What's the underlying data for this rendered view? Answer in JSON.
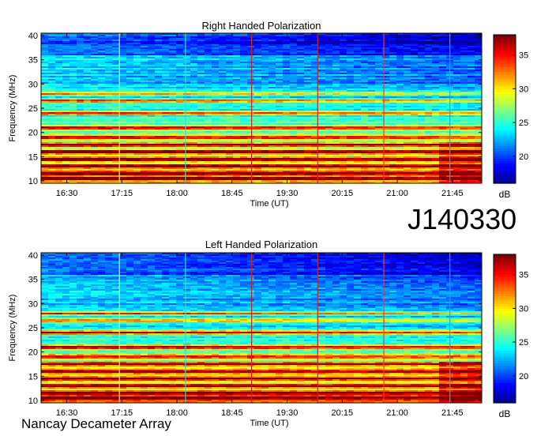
{
  "figure": {
    "observation_id": "J140330",
    "footer": "Nancay Decameter Array"
  },
  "chart_data": [
    {
      "type": "heatmap",
      "title": "Right Handed Polarization",
      "xlabel": "Time (UT)",
      "ylabel": "Frequency (MHz)",
      "x_ticks": [
        "16:30",
        "17:15",
        "18:00",
        "18:45",
        "19:30",
        "20:15",
        "21:00",
        "21:45"
      ],
      "y_ticks": [
        10,
        15,
        20,
        25,
        30,
        35,
        40
      ],
      "ylim": [
        9.5,
        40.5
      ],
      "colorbar": {
        "label": "dB",
        "ticks": [
          20,
          25,
          30,
          35
        ],
        "range": [
          16,
          38
        ],
        "colormap": "jet"
      },
      "bright_bands_mhz": [
        10.5,
        11.5,
        13,
        14.5,
        16,
        17.5,
        19,
        21,
        24,
        26.5,
        28
      ],
      "vertical_markers": [
        {
          "time": "17:13",
          "color": "#ccff66"
        },
        {
          "time": "18:07",
          "color": "#33ddcc"
        },
        {
          "time": "19:01",
          "color": "#cc2222"
        },
        {
          "time": "19:55",
          "color": "#cc2222"
        },
        {
          "time": "20:49",
          "color": "#ff3333"
        },
        {
          "time": "21:43",
          "color": "#3399ff"
        }
      ]
    },
    {
      "type": "heatmap",
      "title": "Left Handed Polarization",
      "xlabel": "Time (UT)",
      "ylabel": "Frequency (MHz)",
      "x_ticks": [
        "16:30",
        "17:15",
        "18:00",
        "18:45",
        "19:30",
        "20:15",
        "21:00",
        "21:45"
      ],
      "y_ticks": [
        10,
        15,
        20,
        25,
        30,
        35,
        40
      ],
      "ylim": [
        9.5,
        40.5
      ],
      "colorbar": {
        "label": "dB",
        "ticks": [
          20,
          25,
          30,
          35
        ],
        "range": [
          16,
          38
        ],
        "colormap": "jet"
      },
      "bright_bands_mhz": [
        10.5,
        11.5,
        13,
        14.5,
        16,
        17.5,
        19,
        21,
        24,
        26.5,
        28
      ],
      "vertical_markers": [
        {
          "time": "17:13",
          "color": "#ccff66"
        },
        {
          "time": "18:07",
          "color": "#33ddcc"
        },
        {
          "time": "19:01",
          "color": "#cc2222"
        },
        {
          "time": "19:55",
          "color": "#cc2222"
        },
        {
          "time": "20:49",
          "color": "#ff3333"
        },
        {
          "time": "21:43",
          "color": "#3399ff"
        }
      ]
    }
  ]
}
